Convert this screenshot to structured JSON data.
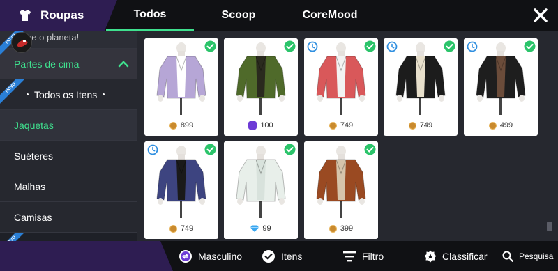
{
  "header": {
    "title": "Roupas",
    "tabs": [
      {
        "label": "Todos",
        "active": true
      },
      {
        "label": "Scoop",
        "active": false
      },
      {
        "label": "CoreMood",
        "active": false
      }
    ]
  },
  "sidebar": {
    "partial_text": "Salve o planeta!",
    "category": "Partes de cima",
    "ribbon_label": "NOVO",
    "items": [
      {
        "label": "Todos os Itens"
      },
      {
        "label": "Jaquetas",
        "selected": true
      },
      {
        "label": "Suéteres"
      },
      {
        "label": "Malhas"
      },
      {
        "label": "Camisas"
      }
    ]
  },
  "items": [
    {
      "price": "899",
      "currency": "coin",
      "owned": true,
      "timed": false,
      "jacket": "#b6a6d6",
      "inner": "#ffffff"
    },
    {
      "price": "100",
      "currency": "purple",
      "owned": true,
      "timed": false,
      "jacket": "#4f6a2a",
      "inner": "#2a2a1e"
    },
    {
      "price": "749",
      "currency": "coin",
      "owned": true,
      "timed": true,
      "jacket": "#d9585a",
      "inner": "#f2f2f2"
    },
    {
      "price": "749",
      "currency": "coin",
      "owned": true,
      "timed": true,
      "jacket": "#1c1c1c",
      "inner": "#e8e0cc"
    },
    {
      "price": "499",
      "currency": "coin",
      "owned": true,
      "timed": true,
      "jacket": "#1e1e1e",
      "inner": "#6b4c3a"
    },
    {
      "price": "749",
      "currency": "coin",
      "owned": true,
      "timed": true,
      "jacket": "#3d4480",
      "inner": "#1a1a1a"
    },
    {
      "price": "99",
      "currency": "diamond",
      "owned": true,
      "timed": false,
      "jacket": "#e8efea",
      "inner": "#d8e2dc"
    },
    {
      "price": "399",
      "currency": "coin",
      "owned": true,
      "timed": false,
      "jacket": "#9a4a22",
      "inner": "#d6c4aa"
    }
  ],
  "bottom_bar": {
    "gender": "Masculino",
    "items": "Itens",
    "filter": "Filtro",
    "sort": "Classificar",
    "search": "Pesquisa"
  },
  "colors": {
    "accent": "#3fe08e",
    "header_purple": "#2e1d52",
    "ribbon_blue": "#2a7fd6",
    "check_green": "#2bc46a",
    "clock_blue": "#2f8fe0"
  }
}
